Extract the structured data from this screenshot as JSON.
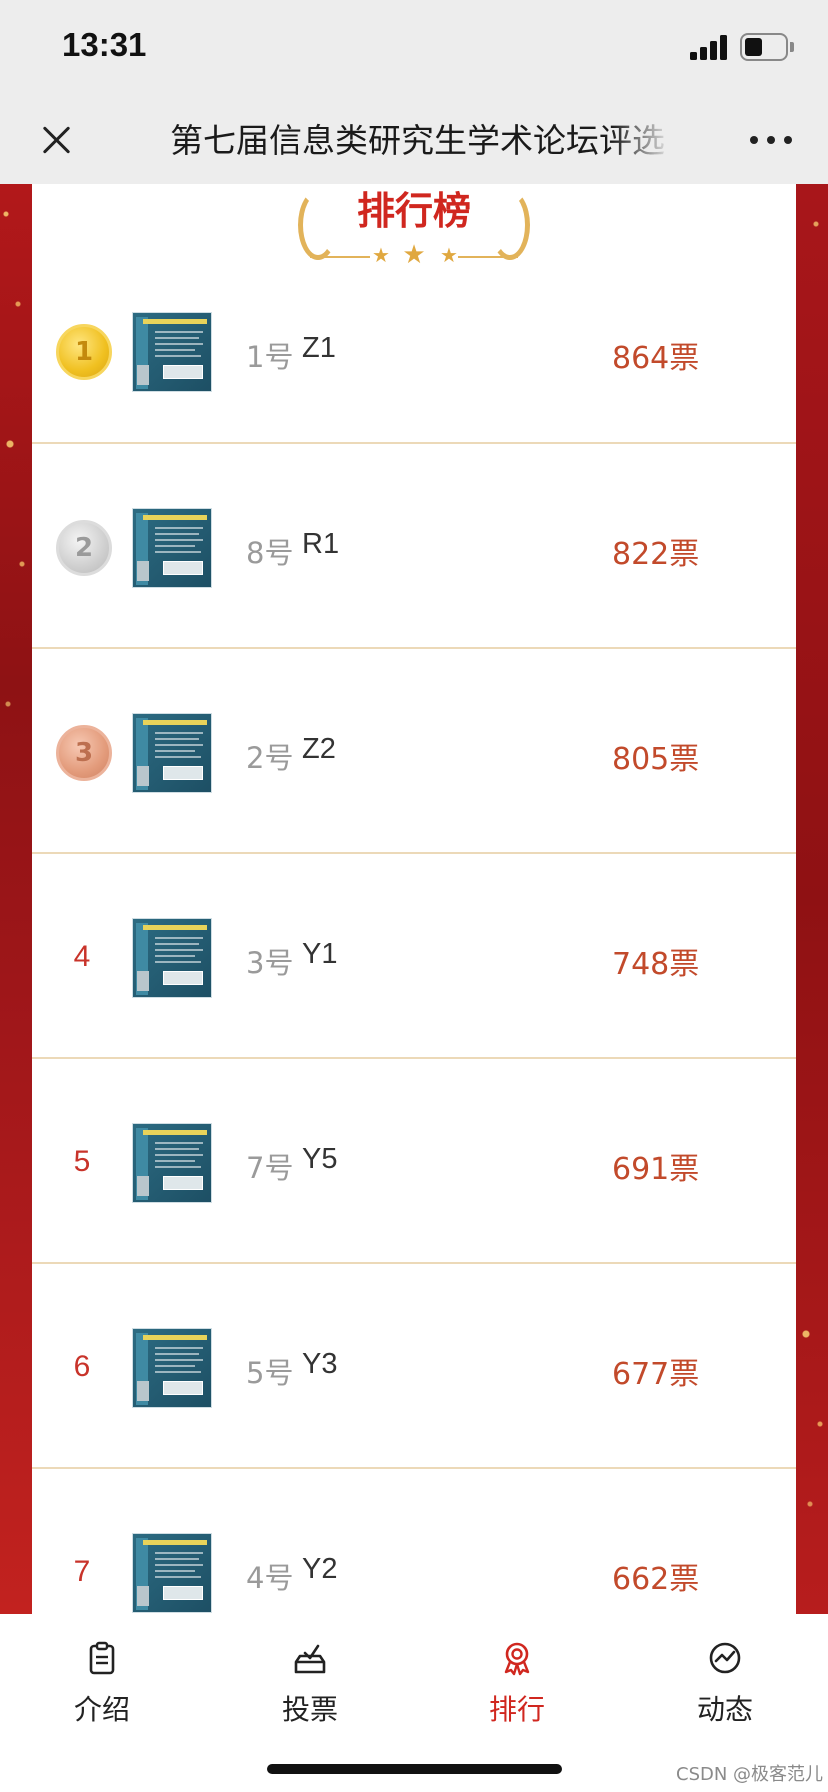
{
  "status_bar": {
    "time": "13:31"
  },
  "title_bar": {
    "title": "第七届信息类研究生学术论坛评选"
  },
  "board": {
    "title": "排行榜"
  },
  "rankings": [
    {
      "rank": "1",
      "number": "1号",
      "name": "Z1",
      "votes": "864票",
      "medal": "gold"
    },
    {
      "rank": "2",
      "number": "8号",
      "name": "R1",
      "votes": "822票",
      "medal": "silver"
    },
    {
      "rank": "3",
      "number": "2号",
      "name": "Z2",
      "votes": "805票",
      "medal": "bronze"
    },
    {
      "rank": "4",
      "number": "3号",
      "name": "Y1",
      "votes": "748票"
    },
    {
      "rank": "5",
      "number": "7号",
      "name": "Y5",
      "votes": "691票"
    },
    {
      "rank": "6",
      "number": "5号",
      "name": "Y3",
      "votes": "677票"
    },
    {
      "rank": "7",
      "number": "4号",
      "name": "Y2",
      "votes": "662票"
    }
  ],
  "tabs": [
    {
      "label": "介绍",
      "icon": "clipboard-icon"
    },
    {
      "label": "投票",
      "icon": "ballot-icon"
    },
    {
      "label": "排行",
      "icon": "award-icon",
      "active": true
    },
    {
      "label": "动态",
      "icon": "trend-icon"
    }
  ],
  "watermark": "CSDN @极客范儿",
  "colors": {
    "accent": "#d0271f",
    "votes": "#c24a2b",
    "divider": "#ecd9b8",
    "side_bg": "#9e1416"
  }
}
